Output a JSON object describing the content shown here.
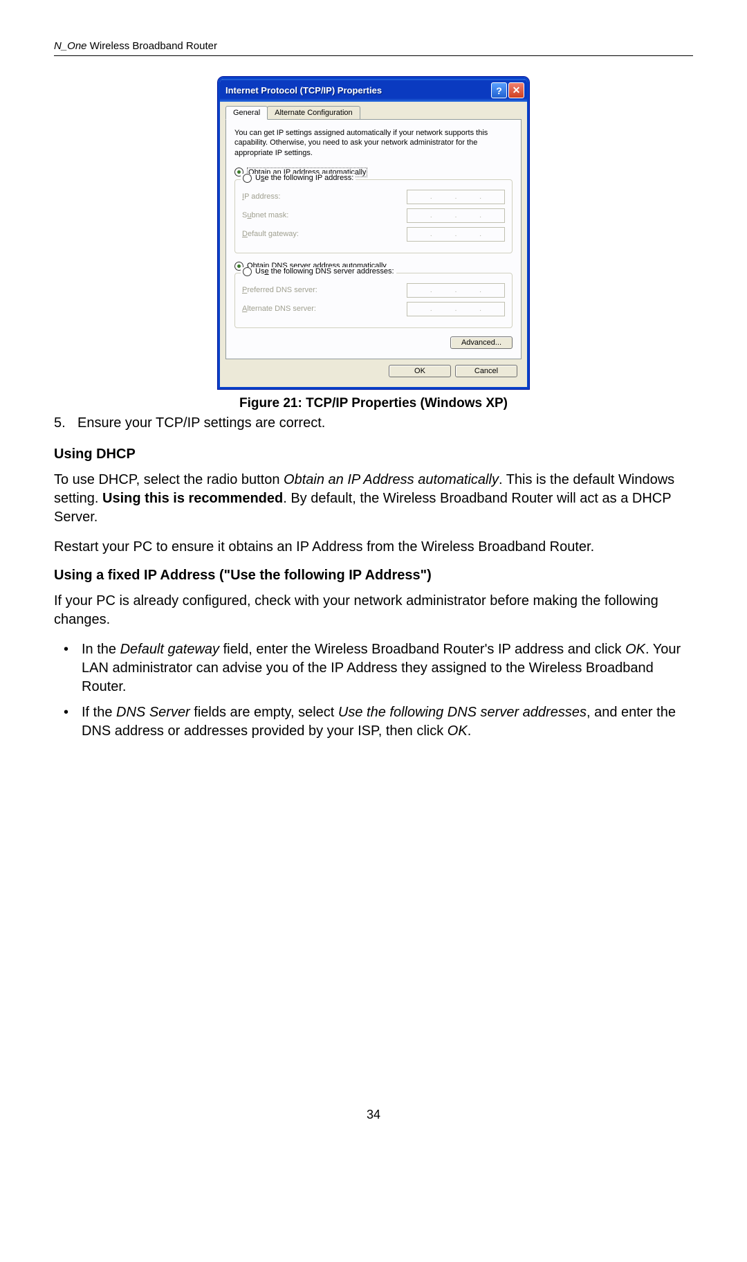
{
  "header": {
    "product_italic": "N_One",
    "product_rest": " Wireless Broadband Router"
  },
  "dialog": {
    "title": "Internet Protocol (TCP/IP) Properties",
    "help_glyph": "?",
    "close_glyph": "✕",
    "tabs": {
      "general": "General",
      "alternate": "Alternate Configuration"
    },
    "description": "You can get IP settings assigned automatically if your network supports this capability. Otherwise, you need to ask your network administrator for the appropriate IP settings.",
    "ip_section": {
      "auto_prefix": "O",
      "auto_rest": "btain an IP address automatically",
      "manual_prefix": "U",
      "manual_mid": "s",
      "manual_rest": "e the following IP address:",
      "ip_label_u": "I",
      "ip_label_rest": "P address:",
      "subnet_label_pre": "S",
      "subnet_label_u": "u",
      "subnet_label_rest": "bnet mask:",
      "gateway_label_u": "D",
      "gateway_label_rest": "efault gateway:"
    },
    "dns_section": {
      "auto_pre": "O",
      "auto_u": "b",
      "auto_rest": "tain DNS server address automatically",
      "manual_pre": "Us",
      "manual_u": "e",
      "manual_rest": " the following DNS server addresses:",
      "preferred_u": "P",
      "preferred_rest": "referred DNS server:",
      "alternate_u": "A",
      "alternate_rest": "lternate DNS server:"
    },
    "advanced": "Advanced...",
    "ok": "OK",
    "cancel": "Cancel"
  },
  "figure_caption": "Figure 21: TCP/IP Properties (Windows XP)",
  "step5_num": "5.",
  "step5_text": "Ensure your TCP/IP settings are correct.",
  "heading_dhcp": "Using DHCP",
  "dhcp_para1_a": "To use DHCP, select the radio button ",
  "dhcp_para1_b": "Obtain an IP Address automatically",
  "dhcp_para1_c": ". This is the default Windows setting. ",
  "dhcp_para1_d": "Using this is recommended",
  "dhcp_para1_e": ". By default, the Wireless Broadband Router will act as a DHCP Server.",
  "dhcp_para2": "Restart your PC to ensure it obtains an IP Address from the Wireless Broadband Router.",
  "heading_fixed": "Using a fixed IP Address (\"Use the following IP Address\")",
  "fixed_para1": "If your PC is already configured, check with your network administrator before making the following changes.",
  "bullet1_a": "In the ",
  "bullet1_b": "Default gateway",
  "bullet1_c": " field, enter the Wireless Broadband Router's IP address and click ",
  "bullet1_d": "OK",
  "bullet1_e": ". Your LAN administrator can advise you of the IP Address they assigned to the Wireless Broadband Router.",
  "bullet2_a": "If the ",
  "bullet2_b": "DNS Server",
  "bullet2_c": " fields are empty, select ",
  "bullet2_d": "Use the following DNS server addresses",
  "bullet2_e": ", and enter the DNS address or addresses provided by your ISP, then click ",
  "bullet2_f": "OK",
  "bullet2_g": ".",
  "page_number": "34"
}
